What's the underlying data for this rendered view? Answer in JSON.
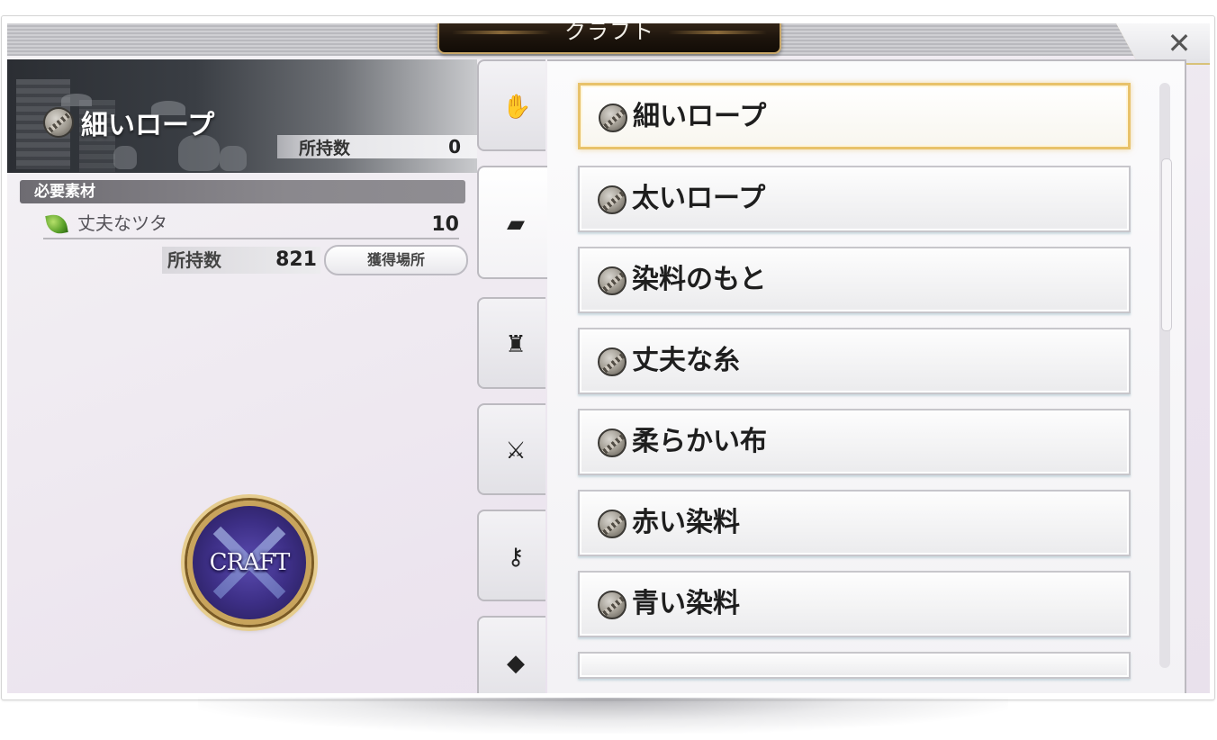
{
  "header": {
    "title": "クラフト"
  },
  "close": {
    "label": "✕"
  },
  "item": {
    "name": "細いロープ",
    "owned_label": "所持数",
    "owned_value": "0"
  },
  "requirements": {
    "header": "必要素材",
    "materials": [
      {
        "name": "丈夫なツタ",
        "qty": "10",
        "owned_label": "所持数",
        "owned_value": "821",
        "acquire_label": "獲得場所"
      }
    ]
  },
  "craft_button": {
    "label": "CRAFT"
  },
  "tabs": [
    {
      "name": "hand-icon",
      "glyph": "✋"
    },
    {
      "name": "material-icon",
      "glyph": "▰"
    },
    {
      "name": "chair-icon",
      "glyph": "♜"
    },
    {
      "name": "weapon-armor-icon",
      "glyph": "⚔"
    },
    {
      "name": "key-icon",
      "glyph": "⚷"
    },
    {
      "name": "cloth-icon",
      "glyph": "◆"
    }
  ],
  "list": [
    {
      "label": "細いロープ"
    },
    {
      "label": "太いロープ"
    },
    {
      "label": "染料のもと"
    },
    {
      "label": "丈夫な糸"
    },
    {
      "label": "柔らかい布"
    },
    {
      "label": "赤い染料"
    },
    {
      "label": "青い染料"
    }
  ],
  "colors": {
    "selected_border": "#e8c26a",
    "craft_ring": "#c8a45c",
    "craft_core": "#3d2f86"
  }
}
